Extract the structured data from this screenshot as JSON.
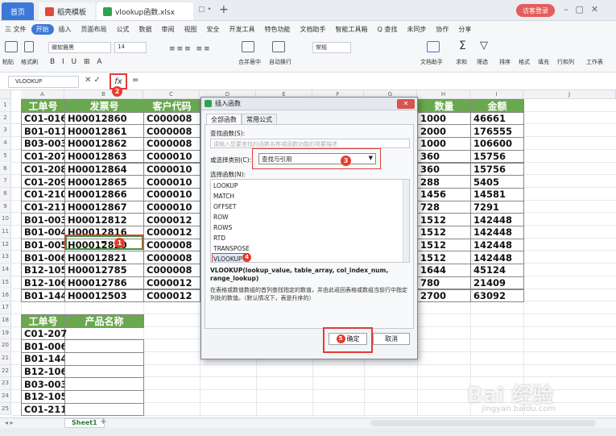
{
  "titlebar": {
    "home_tab": "首页",
    "template_tab": "稻壳模板",
    "file_tab": "vlookup函数.xlsx",
    "login_label": "访客登录"
  },
  "menu": [
    "三 文件",
    "开始",
    "插入",
    "页面布局",
    "公式",
    "数据",
    "审阅",
    "视图",
    "安全",
    "开发工具",
    "特色功能",
    "文档助手",
    "智能工具箱",
    "Q 查找",
    "未同步",
    "协作",
    "分享"
  ],
  "ribbon": {
    "paste": "粘贴",
    "format_painter": "格式刷",
    "font_name": "微软雅黑",
    "font_size": "14",
    "merge": "合并居中",
    "wrap": "自动换行",
    "number_format": "常规",
    "doc_helper": "文档助手",
    "sum": "求和",
    "filter": "筛选",
    "sort": "排序",
    "format": "格式",
    "fill": "填充",
    "rowcol": "行和列",
    "worksheet": "工作表"
  },
  "formula_bar": {
    "name_box": "VLOOKUP",
    "fx": "fx",
    "content": "="
  },
  "columns": [
    "A",
    "B",
    "C",
    "D",
    "E",
    "F",
    "G",
    "H",
    "I",
    "J"
  ],
  "table": {
    "headers": [
      "工单号",
      "发票号",
      "客户代码",
      "数量",
      "金额"
    ],
    "rows": [
      [
        "C01-016",
        "H00012860",
        "C000008",
        "1000",
        "46661"
      ],
      [
        "B01-011",
        "H00012861",
        "C000008",
        "2000",
        "176555"
      ],
      [
        "B03-003",
        "H00012862",
        "C000008",
        "1000",
        "106600"
      ],
      [
        "C01-207",
        "H00012863",
        "C000010",
        "360",
        "15756"
      ],
      [
        "C01-208",
        "H00012864",
        "C000010",
        "360",
        "15756"
      ],
      [
        "C01-209",
        "H00012865",
        "C000010",
        "288",
        "5405"
      ],
      [
        "C01-210",
        "H00012866",
        "C000010",
        "1456",
        "14581"
      ],
      [
        "C01-211",
        "H00012867",
        "C000010",
        "728",
        "7291"
      ],
      [
        "B01-003",
        "H00012812",
        "C000012",
        "1512",
        "142448"
      ],
      [
        "B01-004",
        "H00012816",
        "C000012",
        "1512",
        "142448"
      ],
      [
        "B01-005",
        "H00012820",
        "C000008",
        "1512",
        "142448"
      ],
      [
        "B01-006",
        "H00012821",
        "C000008",
        "1512",
        "142448"
      ],
      [
        "B12-105",
        "H00012785",
        "C000008",
        "1644",
        "45124"
      ],
      [
        "B12-106",
        "H00012786",
        "C000012",
        "780",
        "21409"
      ],
      [
        "B01-144",
        "H00012503",
        "C000012",
        "2700",
        "63092"
      ]
    ]
  },
  "table2": {
    "headers": [
      "工单号",
      "产品名称"
    ],
    "rows": [
      "C01-207",
      "B01-006",
      "B01-144",
      "B12-106",
      "B03-003",
      "B12-105",
      "C01-211"
    ],
    "active_value": "="
  },
  "sheet_tab": "Sheet1",
  "dialog": {
    "title": "插入函数",
    "tab_all": "全部函数",
    "tab_common": "常用公式",
    "search_label": "查找函数(S):",
    "search_placeholder": "请输入您要查找的函数名称或函数功能的简要描述",
    "category_label": "或选择类别(C):",
    "category_value": "查找与引用",
    "select_label": "选择函数(N):",
    "functions": [
      "LOOKUP",
      "MATCH",
      "OFFSET",
      "ROW",
      "ROWS",
      "RTD",
      "TRANSPOSE",
      "VLOOKUP"
    ],
    "signature": "VLOOKUP(lookup_value, table_array, col_index_num, range_lookup)",
    "description": "在表格或数值数组的首列查找指定的数值，并由此返回表格或数组当前行中指定列处的数值。（默认情况下，表是升序的）",
    "ok": "确定",
    "cancel": "取消"
  },
  "badges": [
    "1",
    "2",
    "3",
    "4",
    "5"
  ],
  "watermark": "Bai 经验",
  "watermark_sub": "jingyan.baidu.com",
  "colors": {
    "accent": "#3b78d8",
    "header_green": "#6aa84f",
    "annotation_red": "#e13b3b"
  }
}
